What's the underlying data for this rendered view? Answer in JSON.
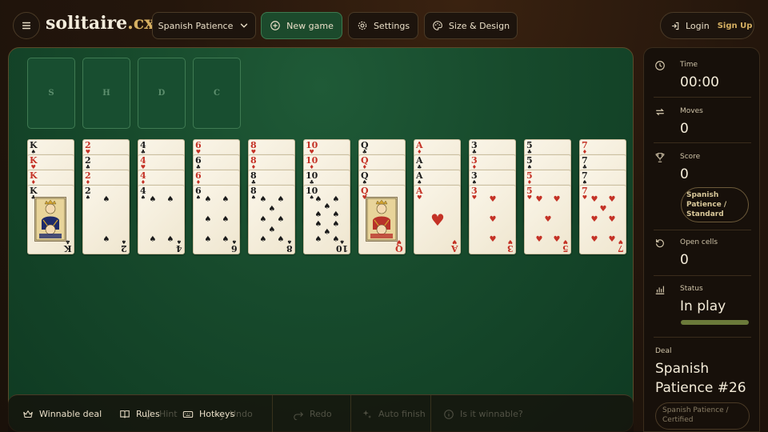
{
  "header": {
    "logo_main": "solitaire",
    "logo_tld": ".cx",
    "variant": "Spanish Patience",
    "new_game": "New game",
    "settings": "Settings",
    "design": "Size & Design",
    "login": "Login",
    "signup": "Sign Up"
  },
  "foundations": [
    "S",
    "H",
    "D",
    "C"
  ],
  "tableau": [
    {
      "color": "black",
      "cards": [
        {
          "rank": "K",
          "suit": "♠"
        },
        {
          "rank": "K",
          "suit": "♥"
        },
        {
          "rank": "K",
          "suit": "♦"
        },
        {
          "rank": "K",
          "suit": "♣"
        }
      ]
    },
    {
      "color": "mixed",
      "cards": [
        {
          "rank": "2",
          "suit": "♥"
        },
        {
          "rank": "2",
          "suit": "♣"
        },
        {
          "rank": "2",
          "suit": "♦"
        },
        {
          "rank": "2",
          "suit": "♠"
        }
      ]
    },
    {
      "color": "mixed",
      "cards": [
        {
          "rank": "4",
          "suit": "♣"
        },
        {
          "rank": "4",
          "suit": "♥"
        },
        {
          "rank": "4",
          "suit": "♦"
        },
        {
          "rank": "4",
          "suit": "♠"
        }
      ]
    },
    {
      "color": "mixed",
      "cards": [
        {
          "rank": "6",
          "suit": "♥"
        },
        {
          "rank": "6",
          "suit": "♣"
        },
        {
          "rank": "6",
          "suit": "♦"
        },
        {
          "rank": "6",
          "suit": "♠"
        }
      ]
    },
    {
      "color": "mixed",
      "cards": [
        {
          "rank": "8",
          "suit": "♥"
        },
        {
          "rank": "8",
          "suit": "♦"
        },
        {
          "rank": "8",
          "suit": "♣"
        },
        {
          "rank": "8",
          "suit": "♠"
        }
      ]
    },
    {
      "color": "mixed",
      "cards": [
        {
          "rank": "10",
          "suit": "♥"
        },
        {
          "rank": "10",
          "suit": "♦"
        },
        {
          "rank": "10",
          "suit": "♣"
        },
        {
          "rank": "10",
          "suit": "♠"
        }
      ]
    },
    {
      "color": "mixed",
      "cards": [
        {
          "rank": "Q",
          "suit": "♣"
        },
        {
          "rank": "Q",
          "suit": "♦"
        },
        {
          "rank": "Q",
          "suit": "♠"
        },
        {
          "rank": "Q",
          "suit": "♥"
        }
      ]
    },
    {
      "color": "mixed",
      "cards": [
        {
          "rank": "A",
          "suit": "♦"
        },
        {
          "rank": "A",
          "suit": "♣"
        },
        {
          "rank": "A",
          "suit": "♠"
        },
        {
          "rank": "A",
          "suit": "♥"
        }
      ]
    },
    {
      "color": "mixed",
      "cards": [
        {
          "rank": "3",
          "suit": "♣"
        },
        {
          "rank": "3",
          "suit": "♦"
        },
        {
          "rank": "3",
          "suit": "♠"
        },
        {
          "rank": "3",
          "suit": "♥"
        }
      ]
    },
    {
      "color": "mixed",
      "cards": [
        {
          "rank": "5",
          "suit": "♣"
        },
        {
          "rank": "5",
          "suit": "♠"
        },
        {
          "rank": "5",
          "suit": "♦"
        },
        {
          "rank": "5",
          "suit": "♥"
        }
      ]
    },
    {
      "color": "mixed",
      "cards": [
        {
          "rank": "7",
          "suit": "♦"
        },
        {
          "rank": "7",
          "suit": "♣"
        },
        {
          "rank": "7",
          "suit": "♠"
        },
        {
          "rank": "7",
          "suit": "♥"
        }
      ]
    }
  ],
  "bottombar": {
    "winnable": "Winnable deal",
    "rules": "Rules",
    "hotkeys": "Hotkeys",
    "hint": "Hint",
    "undo": "Undo",
    "redo": "Redo",
    "auto_finish": "Auto finish",
    "is_winnable": "Is it winnable?"
  },
  "sidebar": {
    "time_label": "Time",
    "time_value": "00:00",
    "moves_label": "Moves",
    "moves_value": "0",
    "score_label": "Score",
    "score_value": "0",
    "score_mode": "Spanish Patience / Standard",
    "open_cells_label": "Open cells",
    "open_cells_value": "0",
    "status_label": "Status",
    "status_value": "In play",
    "status_progress": 1.0,
    "deal_label": "Deal",
    "deal_name": "Spanish Patience #26",
    "deal_mode": "Spanish Patience / Certified"
  },
  "colors": {
    "accent_gold": "#d6b062",
    "felt": "#174a2c",
    "red_suit": "#c43226"
  }
}
